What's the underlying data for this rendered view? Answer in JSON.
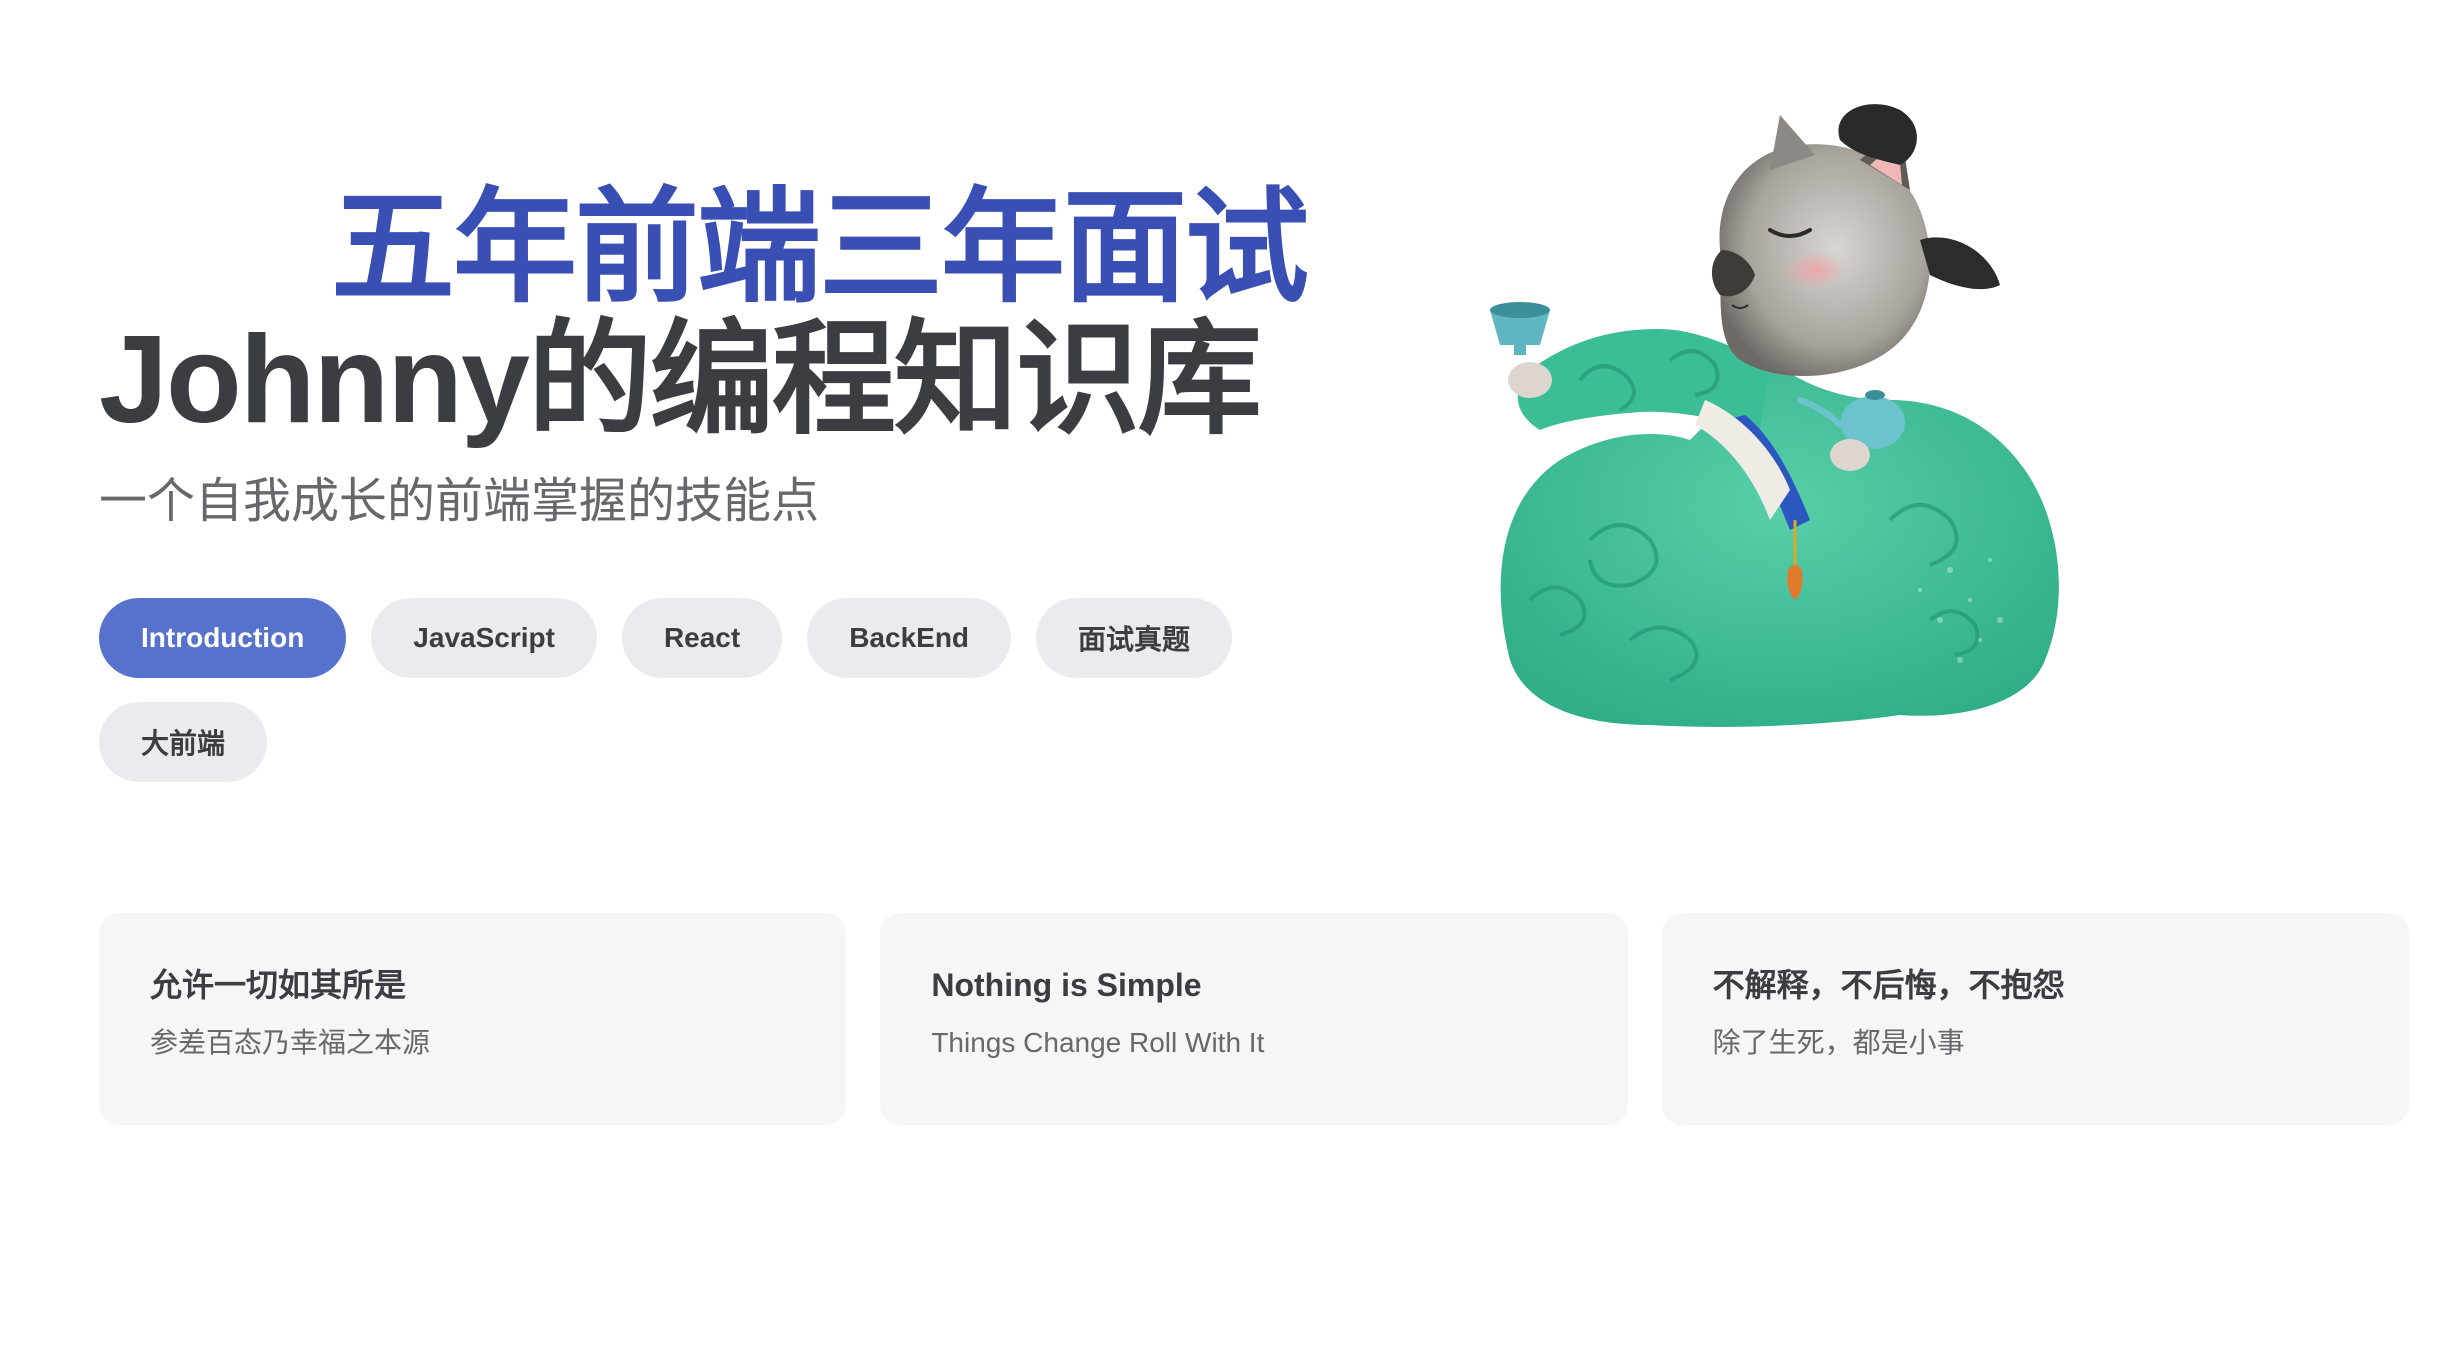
{
  "hero": {
    "name": "五年前端三年面试",
    "title": "Johnny的编程知识库",
    "tagline": "一个自我成长的前端掌握的技能点",
    "image": "cat-in-green-robe-holding-teacup-illustration",
    "actions": [
      {
        "label": "Introduction",
        "theme": "brand"
      },
      {
        "label": "JavaScript",
        "theme": "alt"
      },
      {
        "label": "React",
        "theme": "alt"
      },
      {
        "label": "BackEnd",
        "theme": "alt"
      },
      {
        "label": "面试真题",
        "theme": "alt"
      },
      {
        "label": "大前端",
        "theme": "alt"
      }
    ]
  },
  "features": [
    {
      "title": "允许一切如其所是",
      "details": "参差百态乃幸福之本源"
    },
    {
      "title": "Nothing is Simple",
      "details": "Things Change Roll With It"
    },
    {
      "title": "不解释，不后悔，不抱怨",
      "details": "除了生死，都是小事"
    }
  ],
  "colors": {
    "brand": "#5672cd",
    "name": "#3a4fb4",
    "text": "#3c3c43",
    "muted": "#67676c",
    "button_alt_bg": "#ebebef",
    "card_bg": "#f6f6f7",
    "robe": "#3dbf9a"
  }
}
